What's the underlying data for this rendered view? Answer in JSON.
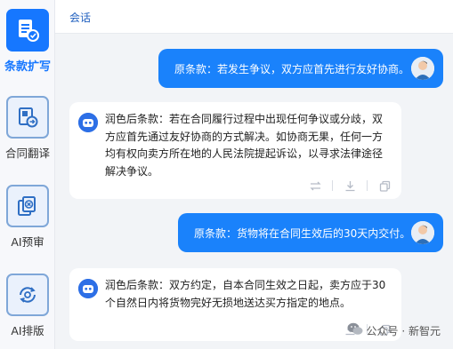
{
  "sidebar": {
    "items": [
      {
        "label": "条款扩写",
        "icon": "document-edit-icon",
        "active": true
      },
      {
        "label": "合同翻译",
        "icon": "book-translate-icon",
        "active": false
      },
      {
        "label": "AI预审",
        "icon": "file-review-icon",
        "active": false
      },
      {
        "label": "AI排版",
        "icon": "layout-refresh-icon",
        "active": false
      }
    ]
  },
  "header": {
    "title": "会话"
  },
  "conversation": [
    {
      "role": "user",
      "text": "原条款：若发生争议，双方应首先进行友好协商。"
    },
    {
      "role": "assistant",
      "text": "润色后条款：若在合同履行过程中出现任何争议或分歧，双方应首先通过友好协商的方式解决。如协商无果，任何一方均有权向卖方所在地的人民法院提起诉讼，以寻求法律途径解决争议。"
    },
    {
      "role": "user",
      "text": "原条款：货物将在合同生效后的30天内交付。"
    },
    {
      "role": "assistant",
      "text": "润色后条款：双方约定，自本合同生效之日起，卖方应于30个自然日内将货物完好无损地送达买方指定的地点。"
    }
  ],
  "watermark": {
    "text": "公众号 · 新智元"
  },
  "colors": {
    "accent": "#1677ff",
    "bubble": "#1a82fb"
  }
}
